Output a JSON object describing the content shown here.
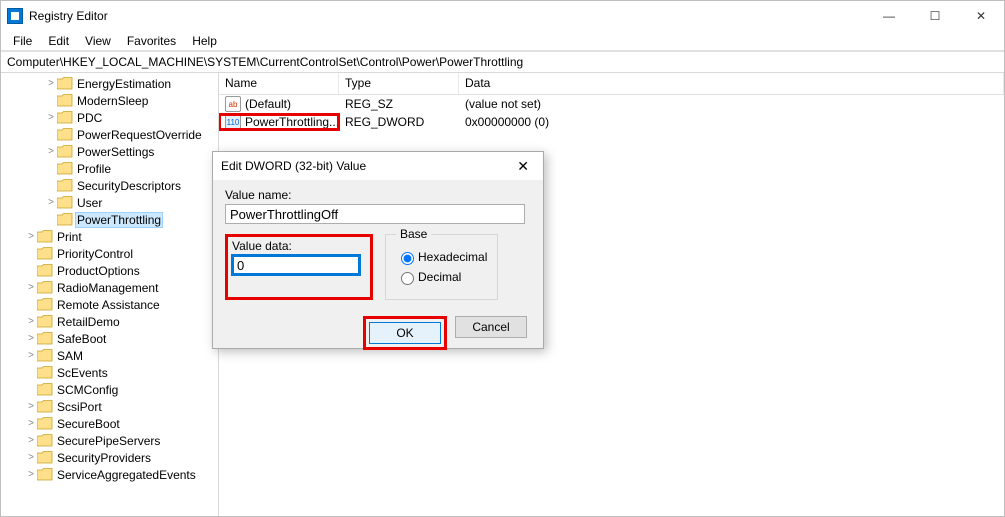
{
  "window_title": "Registry Editor",
  "title_controls": {
    "min": "—",
    "max": "☐",
    "close": "✕"
  },
  "menubar": [
    "File",
    "Edit",
    "View",
    "Favorites",
    "Help"
  ],
  "address": "Computer\\HKEY_LOCAL_MACHINE\\SYSTEM\\CurrentControlSet\\Control\\Power\\PowerThrottling",
  "tree": [
    {
      "label": "EnergyEstimation",
      "exp": ">",
      "indent": 1
    },
    {
      "label": "ModernSleep",
      "exp": "",
      "indent": 1
    },
    {
      "label": "PDC",
      "exp": ">",
      "indent": 1
    },
    {
      "label": "PowerRequestOverride",
      "exp": "",
      "indent": 1
    },
    {
      "label": "PowerSettings",
      "exp": ">",
      "indent": 1
    },
    {
      "label": "Profile",
      "exp": "",
      "indent": 1
    },
    {
      "label": "SecurityDescriptors",
      "exp": "",
      "indent": 1
    },
    {
      "label": "User",
      "exp": ">",
      "indent": 1
    },
    {
      "label": "PowerThrottling",
      "exp": "",
      "indent": 1,
      "selected": true
    },
    {
      "label": "Print",
      "exp": ">",
      "indent": 0
    },
    {
      "label": "PriorityControl",
      "exp": "",
      "indent": 0
    },
    {
      "label": "ProductOptions",
      "exp": "",
      "indent": 0
    },
    {
      "label": "RadioManagement",
      "exp": ">",
      "indent": 0
    },
    {
      "label": "Remote Assistance",
      "exp": "",
      "indent": 0
    },
    {
      "label": "RetailDemo",
      "exp": ">",
      "indent": 0
    },
    {
      "label": "SafeBoot",
      "exp": ">",
      "indent": 0
    },
    {
      "label": "SAM",
      "exp": ">",
      "indent": 0
    },
    {
      "label": "ScEvents",
      "exp": "",
      "indent": 0
    },
    {
      "label": "SCMConfig",
      "exp": "",
      "indent": 0
    },
    {
      "label": "ScsiPort",
      "exp": ">",
      "indent": 0
    },
    {
      "label": "SecureBoot",
      "exp": ">",
      "indent": 0
    },
    {
      "label": "SecurePipeServers",
      "exp": ">",
      "indent": 0
    },
    {
      "label": "SecurityProviders",
      "exp": ">",
      "indent": 0
    },
    {
      "label": "ServiceAggregatedEvents",
      "exp": ">",
      "indent": 0
    }
  ],
  "list": {
    "headers": {
      "name": "Name",
      "type": "Type",
      "data": "Data"
    },
    "rows": [
      {
        "icon": "sz",
        "name": "(Default)",
        "type": "REG_SZ",
        "data": "(value not set)",
        "highlight": false
      },
      {
        "icon": "dw",
        "name": "PowerThrottling...",
        "type": "REG_DWORD",
        "data": "0x00000000 (0)",
        "highlight": true
      }
    ]
  },
  "dialog": {
    "title": "Edit DWORD (32-bit) Value",
    "value_name_label": "Value name:",
    "value_name": "PowerThrottlingOff",
    "value_data_label": "Value data:",
    "value_data": "0",
    "base_label": "Base",
    "radio_hex": "Hexadecimal",
    "radio_dec": "Decimal",
    "ok": "OK",
    "cancel": "Cancel"
  }
}
